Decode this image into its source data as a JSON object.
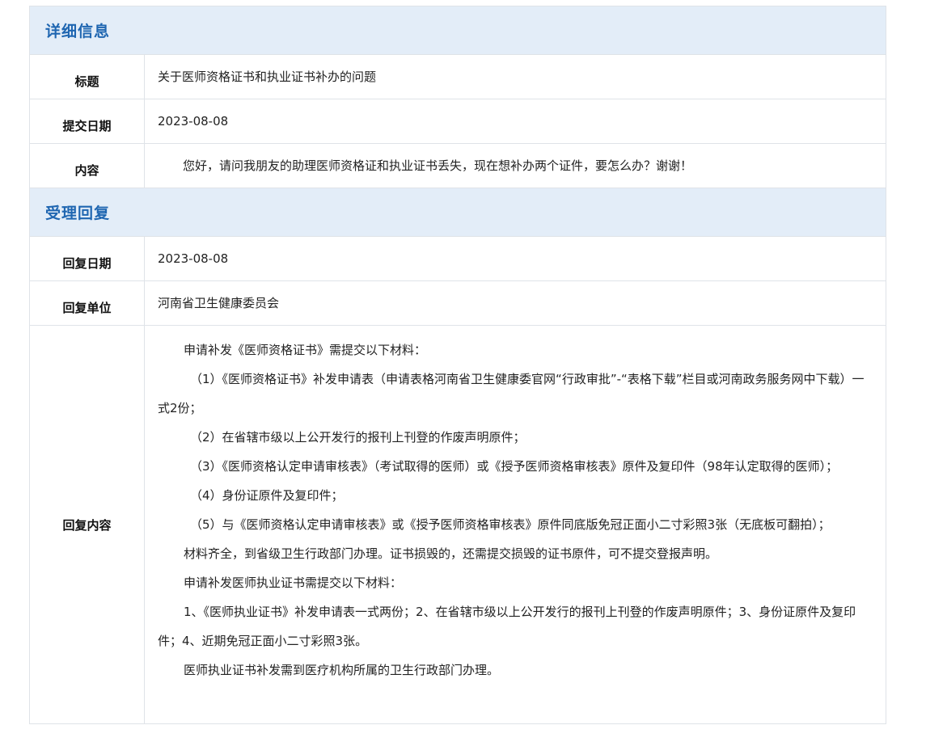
{
  "details": {
    "section_title": "详细信息",
    "title_label": "标题",
    "title_value": "关于医师资格证书和执业证书补办的问题",
    "date_label": "提交日期",
    "date_value": "2023-08-08",
    "content_label": "内容",
    "content_value": "您好，请问我朋友的助理医师资格证和执业证书丢失，现在想补办两个证件，要怎么办？谢谢！"
  },
  "reply": {
    "section_title": "受理回复",
    "date_label": "回复日期",
    "date_value": "2023-08-08",
    "unit_label": "回复单位",
    "unit_value": "河南省卫生健康委员会",
    "content_label": "回复内容",
    "paragraphs": [
      "申请补发《医师资格证书》需提交以下材料：",
      "（1）《医师资格证书》补发申请表（申请表格河南省卫生健康委官网“行政审批”-“表格下载”栏目或河南政务服务网中下载）一式2份；",
      "（2）在省辖市级以上公开发行的报刊上刊登的作废声明原件；",
      "（3）《医师资格认定申请审核表》（考试取得的医师）或《授予医师资格审核表》原件及复印件（98年认定取得的医师）；",
      "（4）身份证原件及复印件；",
      "（5）与《医师资格认定申请审核表》或《授予医师资格审核表》原件同底版免冠正面小二寸彩照3张（无底板可翻拍）；",
      "材料齐全，到省级卫生行政部门办理。证书损毁的，还需提交损毁的证书原件，可不提交登报声明。",
      "申请补发医师执业证书需提交以下材料：",
      "1、《医师执业证书》补发申请表一式两份；2、在省辖市级以上公开发行的报刊上刊登的作废声明原件；3、身份证原件及复印件；4、近期免冠正面小二寸彩照3张。",
      "医师执业证书补发需到医疗机构所属的卫生行政部门办理。"
    ]
  }
}
